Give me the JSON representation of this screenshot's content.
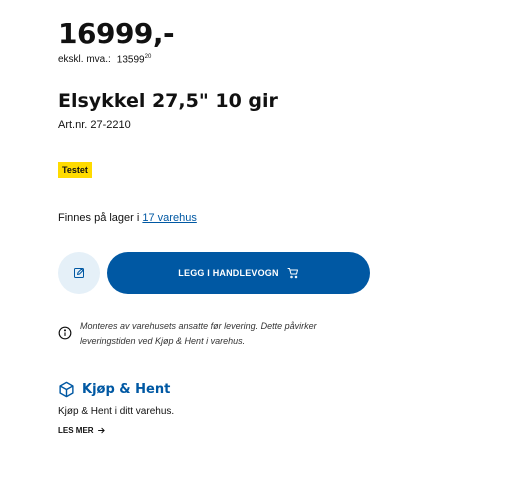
{
  "price": {
    "main": "16999,-"
  },
  "excl_vat": {
    "label": "ekskl. mva.:",
    "value": "13599",
    "cents": "20"
  },
  "product": {
    "title": "Elsykkel 27,5\" 10 gir",
    "art_nr": "Art.nr. 27-2210"
  },
  "badge": {
    "label": "Testet",
    "color": "#ffdb00"
  },
  "stock": {
    "prefix": "Finnes på lager i",
    "link": "17 varehus"
  },
  "actions": {
    "edit_icon": "pencil-icon",
    "add_to_cart": "LEGG I HANDLEVOGN",
    "cart_icon": "cart-icon",
    "accent": "#0058a3",
    "edit_bg": "#e5f0f8"
  },
  "info": {
    "icon": "info-icon",
    "text": "Monteres av varehusets ansatte før levering. Dette påvirker leveringstiden ved Kjøp & Hent i varehus."
  },
  "click_collect": {
    "icon": "box-icon",
    "title": "Kjøp & Hent",
    "description": "Kjøp & Hent i ditt varehus.",
    "read_more": "LES MER",
    "arrow_icon": "arrow-right-icon"
  }
}
